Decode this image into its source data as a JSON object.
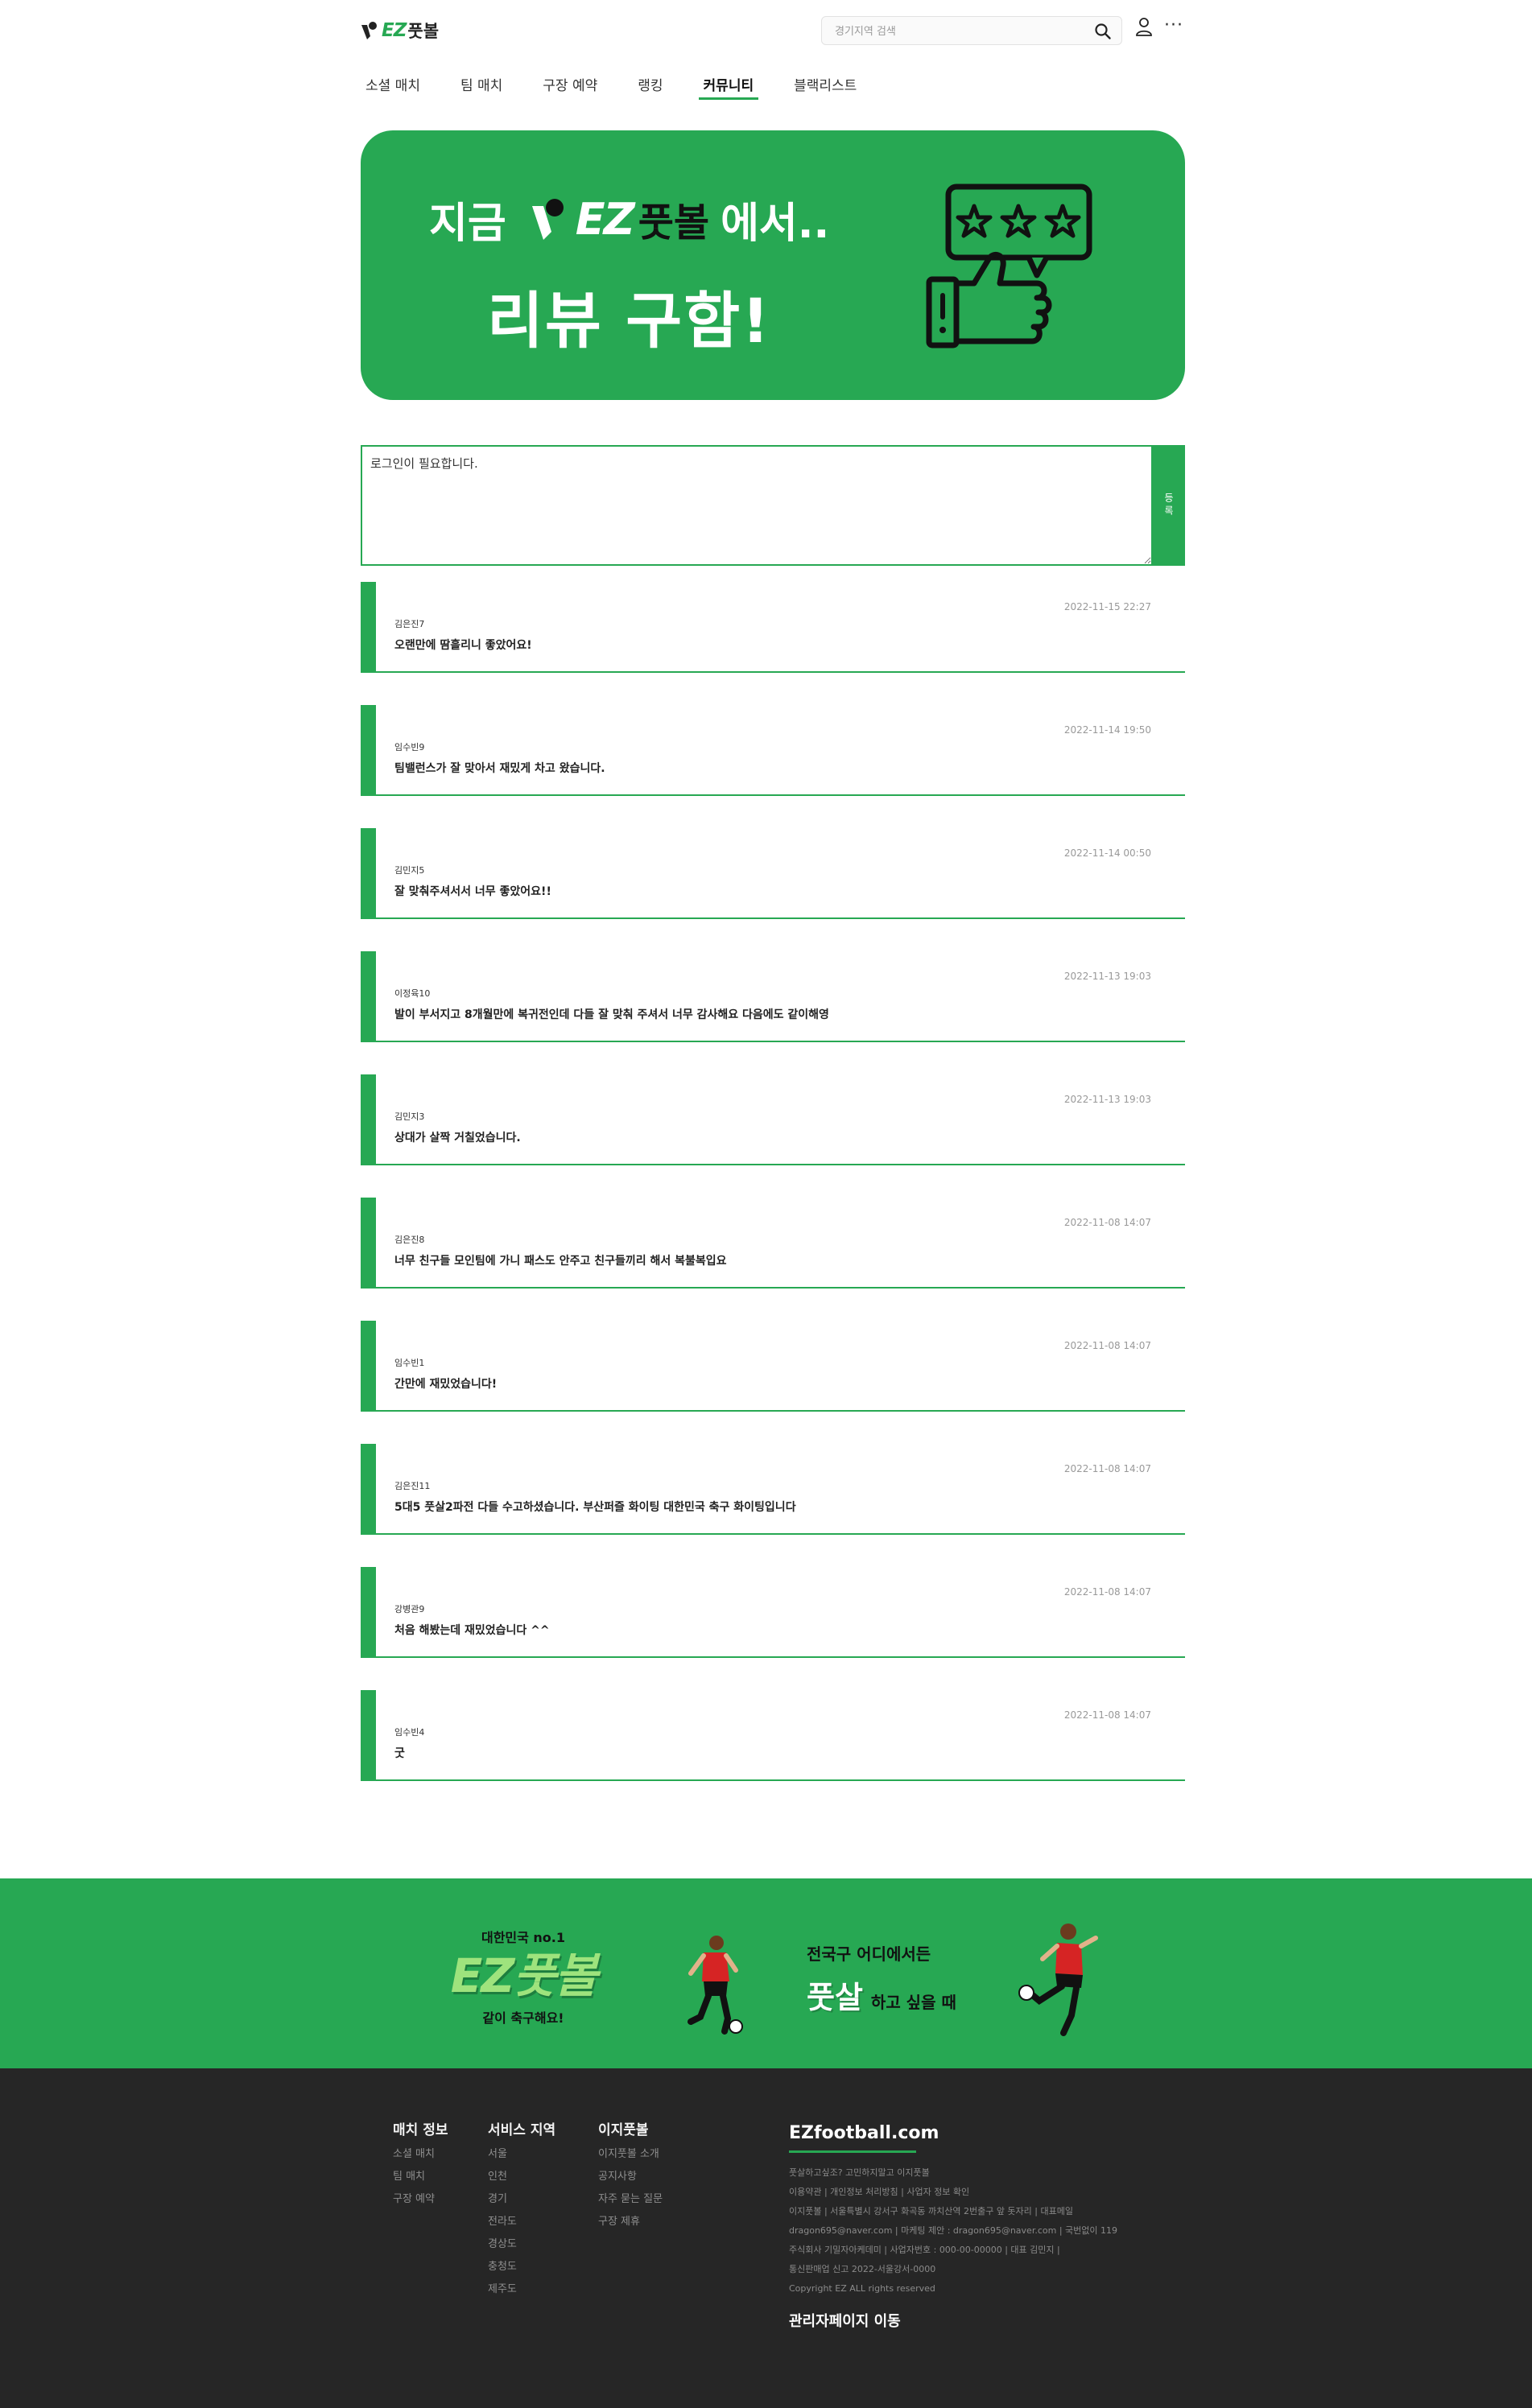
{
  "header": {
    "logo_ez": "EZ",
    "logo_kr": "풋볼",
    "search_placeholder": "경기지역 검색"
  },
  "nav": {
    "tabs": [
      {
        "label": "소셜 매치",
        "active": false
      },
      {
        "label": "팀 매치",
        "active": false
      },
      {
        "label": "구장 예약",
        "active": false
      },
      {
        "label": "랭킹",
        "active": false
      },
      {
        "label": "커뮤니티",
        "active": true
      },
      {
        "label": "블랙리스트",
        "active": false
      }
    ]
  },
  "banner": {
    "line1_pre": "지금",
    "line1_ez": "EZ",
    "line1_kr": "풋볼",
    "line1_post": "에서..",
    "line2": "리뷰 구함!"
  },
  "review_form": {
    "value": "로그인이 필요합니다.",
    "submit_label": "등록"
  },
  "reviews": [
    {
      "author": "김은진7",
      "text": "오랜만에 땀흘리니 좋았어요!",
      "date": "2022-11-15 22:27"
    },
    {
      "author": "임수빈9",
      "text": "팀밸런스가 잘 맞아서 재밌게 차고 왔습니다.",
      "date": "2022-11-14 19:50"
    },
    {
      "author": "김민지5",
      "text": "잘 맞춰주셔서서 너무 좋았어요!!",
      "date": "2022-11-14 00:50"
    },
    {
      "author": "이정육10",
      "text": "발이 부서지고 8개월만에 복귀전인데 다들 잘 맞춰 주셔서 너무 감사해요 다음에도 같이해영",
      "date": "2022-11-13 19:03"
    },
    {
      "author": "김민지3",
      "text": "상대가 살짝 거칠었습니다.",
      "date": "2022-11-13 19:03"
    },
    {
      "author": "김은진8",
      "text": "너무 친구들 모인팀에 가니 패스도 안주고 친구들끼리 해서 복불복입요",
      "date": "2022-11-08 14:07"
    },
    {
      "author": "임수빈1",
      "text": "간만에 재밌었습니다!",
      "date": "2022-11-08 14:07"
    },
    {
      "author": "김은진11",
      "text": "5대5 풋살2파전 다들 수고하셨습니다. 부산퍼즐 화이팅 대한민국 축구 화이팅입니다",
      "date": "2022-11-08 14:07"
    },
    {
      "author": "강병관9",
      "text": "처음 해봤는데 재밌었습니다 ^^",
      "date": "2022-11-08 14:07"
    },
    {
      "author": "임수빈4",
      "text": "굿",
      "date": "2022-11-08 14:07"
    }
  ],
  "promo": {
    "left_small": "대한민국 no.1",
    "left_brand": "EZ풋볼",
    "left_tag": "같이 축구해요!",
    "right_line1": "전국구 어디에서든",
    "right_big": "풋살",
    "right_rest": "하고 싶을 때"
  },
  "footer": {
    "columns": [
      {
        "head": "매치 정보",
        "links": [
          "소셜 매치",
          "팀 매치",
          "구장 예약"
        ]
      },
      {
        "head": "서비스 지역",
        "links": [
          "서울",
          "인천",
          "경기",
          "전라도",
          "경상도",
          "충청도",
          "제주도"
        ]
      },
      {
        "head": "이지풋볼",
        "links": [
          "이지풋볼 소개",
          "공지사항",
          "자주 묻는 질문",
          "구장 제휴"
        ]
      }
    ],
    "brand": "EZfootball.com",
    "info_lines": [
      "풋살하고싶조? 고민하지말고 이지풋볼",
      "이용약관 | 개인정보 처리방침 | 사업자 정보 확인",
      "이지풋볼 | 서울특별시 강서구 화곡동 까치산역 2번출구 앞 돗자리 | 대표메일",
      "dragon695@naver.com | 마케팅 제안 : dragon695@naver.com | 국번없이 119",
      "주식회사 기밀자아케데미 | 사업자번호 : 000-00-00000 | 대표 김민지 |",
      "통신판매업 신고 2022-서울강서-0000",
      "Copyright EZ ALL rights reserved"
    ],
    "admin_link": "관리자페이지 이동"
  }
}
